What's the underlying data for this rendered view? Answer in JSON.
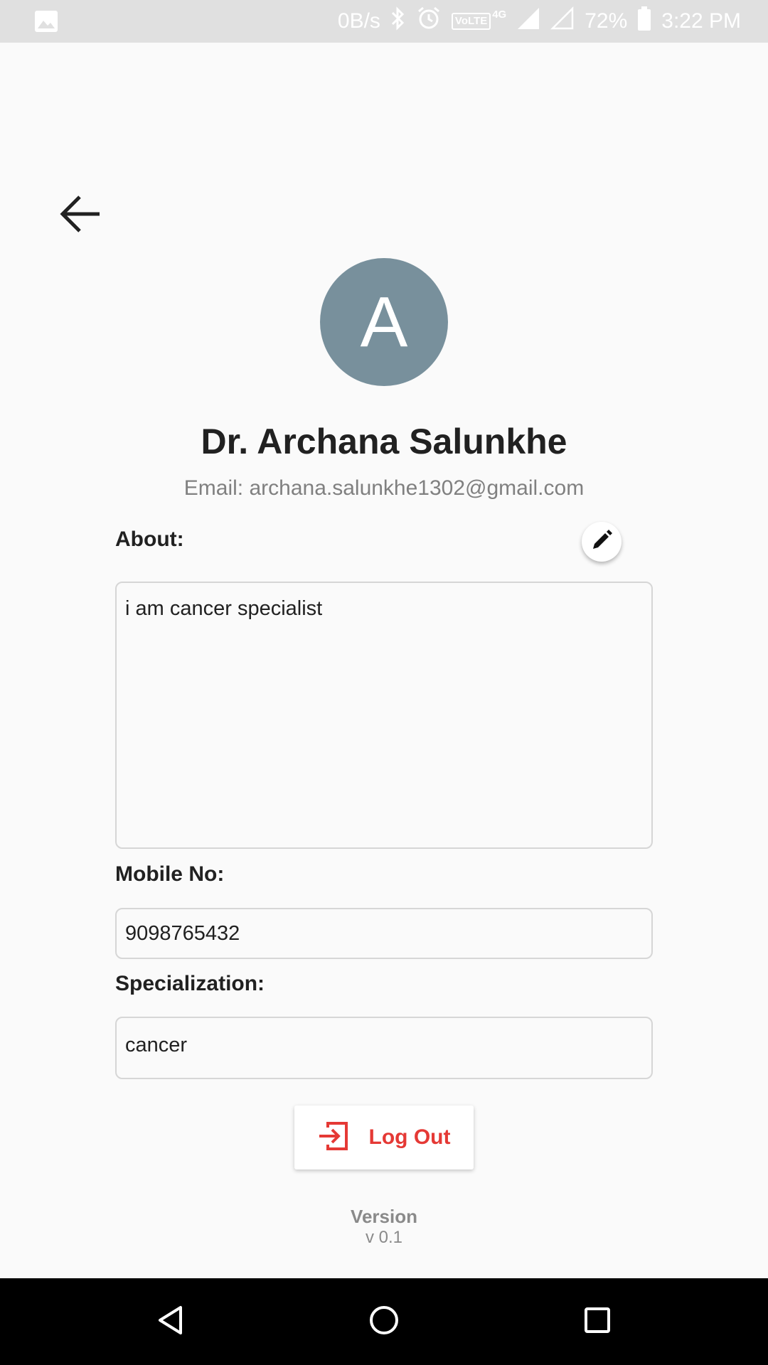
{
  "status_bar": {
    "net_speed": "0B/s",
    "volte": "VoLTE",
    "network": "4G",
    "battery": "72%",
    "time": "3:22 PM"
  },
  "profile": {
    "avatar_letter": "A",
    "name": "Dr. Archana Salunkhe",
    "email_line": "Email: archana.salunkhe1302@gmail.com",
    "avatar_color": "#78909c"
  },
  "about": {
    "label": "About:",
    "value": "i am cancer specialist"
  },
  "mobile": {
    "label": "Mobile No:",
    "value": "9098765432"
  },
  "specialization": {
    "label": "Specialization:",
    "value": "cancer"
  },
  "logout": {
    "label": "Log Out",
    "color": "#e53935"
  },
  "version": {
    "label": "Version",
    "value": "v 0.1"
  },
  "icons": {
    "back": "arrow-left-icon",
    "edit": "pencil-icon",
    "logout": "exit-icon",
    "nav_back": "triangle-back-icon",
    "nav_home": "circle-home-icon",
    "nav_recents": "square-recents-icon"
  }
}
